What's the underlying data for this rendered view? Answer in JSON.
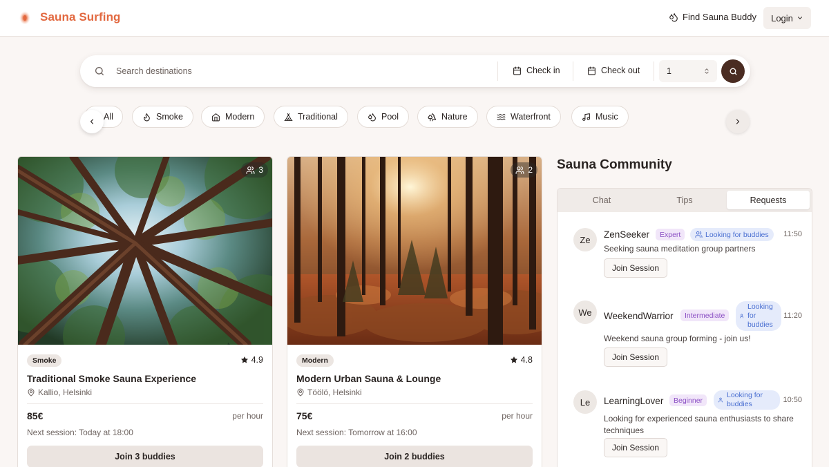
{
  "header": {
    "brand": "Sauna Surfing",
    "find_buddy": "Find Sauna Buddy",
    "login": "Login"
  },
  "search": {
    "placeholder": "Search destinations",
    "check_in": "Check in",
    "check_out": "Check out",
    "guests": "1"
  },
  "categories": [
    {
      "label": "All",
      "icon": "none"
    },
    {
      "label": "Smoke",
      "icon": "flame-icon"
    },
    {
      "label": "Modern",
      "icon": "home-icon"
    },
    {
      "label": "Traditional",
      "icon": "tent-icon"
    },
    {
      "label": "Pool",
      "icon": "droplets-icon"
    },
    {
      "label": "Nature",
      "icon": "trees-icon"
    },
    {
      "label": "Waterfront",
      "icon": "waves-icon"
    },
    {
      "label": "Music",
      "icon": "music-icon"
    }
  ],
  "saunas": [
    {
      "people": "3",
      "type": "Smoke",
      "rating": "4.9",
      "title": "Traditional Smoke Sauna Experience",
      "location": "Kallio, Helsinki",
      "price": "85€",
      "unit": "per hour",
      "next_session": "Next session: Today at 18:00",
      "join": "Join 3 buddies"
    },
    {
      "people": "2",
      "type": "Modern",
      "rating": "4.8",
      "title": "Modern Urban Sauna & Lounge",
      "location": "Töölö, Helsinki",
      "price": "75€",
      "unit": "per hour",
      "next_session": "Next session: Tomorrow at 16:00",
      "join": "Join 2 buddies"
    }
  ],
  "community": {
    "title": "Sauna Community",
    "tabs": [
      "Chat",
      "Tips",
      "Requests"
    ],
    "active_tab": "Requests",
    "requests": [
      {
        "initials": "Ze",
        "name": "ZenSeeker",
        "level": "Expert",
        "looking": "Looking for buddies",
        "time": "11:50",
        "message": "Seeking sauna meditation group partners",
        "action": "Join Session"
      },
      {
        "initials": "We",
        "name": "WeekendWarrior",
        "level": "Intermediate",
        "looking": "Looking for buddies",
        "time": "11:20",
        "message": "Weekend sauna group forming - join us!",
        "action": "Join Session"
      },
      {
        "initials": "Le",
        "name": "LearningLover",
        "level": "Beginner",
        "looking": "Looking for buddies",
        "time": "10:50",
        "message": "Looking for experienced sauna enthusiasts to share techniques",
        "action": "Join Session"
      }
    ]
  },
  "colors": {
    "brand": "#e2683f",
    "search_button": "#4a2c22",
    "badge_level_bg": "#f1e6f9",
    "badge_level_fg": "#8b4fc4",
    "badge_looking_bg": "#e5ebfb",
    "badge_looking_fg": "#4a6fd1"
  }
}
